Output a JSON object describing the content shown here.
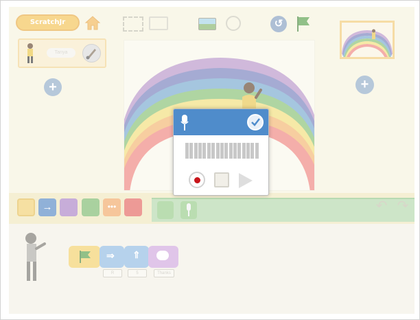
{
  "app": {
    "logo_text": "ScratchJr"
  },
  "sprite_panel": {
    "sprite_name": "Tanya"
  },
  "palette": {
    "colors": [
      "#f1ce6a",
      "#4d82c1",
      "#a57bc2",
      "#74b564",
      "#f0a35e",
      "#e25c56"
    ]
  },
  "script": {
    "blocks": [
      {
        "type": "green-flag",
        "label": ""
      },
      {
        "type": "move-right",
        "label": "R"
      },
      {
        "type": "move-up",
        "label": "5"
      },
      {
        "type": "say",
        "label": "Thanks"
      }
    ]
  },
  "recorder": {
    "meter_segments": 17
  },
  "colors": {
    "overlay": "rgba(255,255,255,0.38)",
    "dialog_header": "#4f8ccb",
    "record_dot": "#c8151b",
    "motion_category": "#aed6a6"
  }
}
